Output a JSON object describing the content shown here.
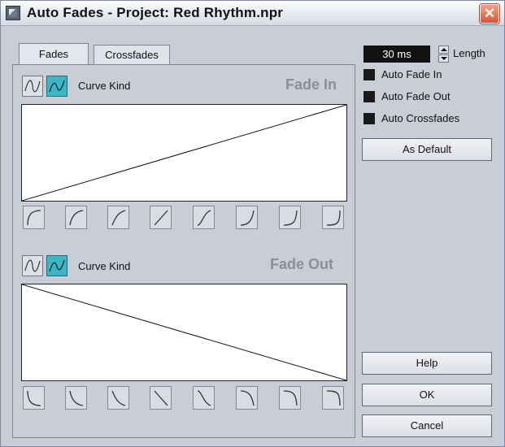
{
  "window": {
    "title": "Auto Fades - Project: Red Rhythm.npr",
    "close_symbol": "✕"
  },
  "tabs": [
    {
      "label": "Fades",
      "active": true
    },
    {
      "label": "Crossfades",
      "active": false
    }
  ],
  "fade_in": {
    "curve_kind_label": "Curve Kind",
    "title": "Fade In"
  },
  "fade_out": {
    "curve_kind_label": "Curve Kind",
    "title": "Fade Out"
  },
  "length": {
    "value": "30 ms",
    "label": "Length"
  },
  "options": [
    {
      "label": "Auto Fade In",
      "checked": true
    },
    {
      "label": "Auto Fade Out",
      "checked": true
    },
    {
      "label": "Auto Crossfades",
      "checked": true
    }
  ],
  "buttons": {
    "as_default": "As Default",
    "help": "Help",
    "ok": "OK",
    "cancel": "Cancel"
  },
  "colors": {
    "accent": "#3fb6c6",
    "field_bg": "#111111",
    "panel": "#c9cdd6",
    "heading": "#8a8f98"
  },
  "icons": [
    "spline-curve-icon",
    "damped-spline-curve-icon",
    "fade-preset-icon",
    "spinner-up-icon",
    "spinner-down-icon",
    "close-icon",
    "app-icon"
  ]
}
